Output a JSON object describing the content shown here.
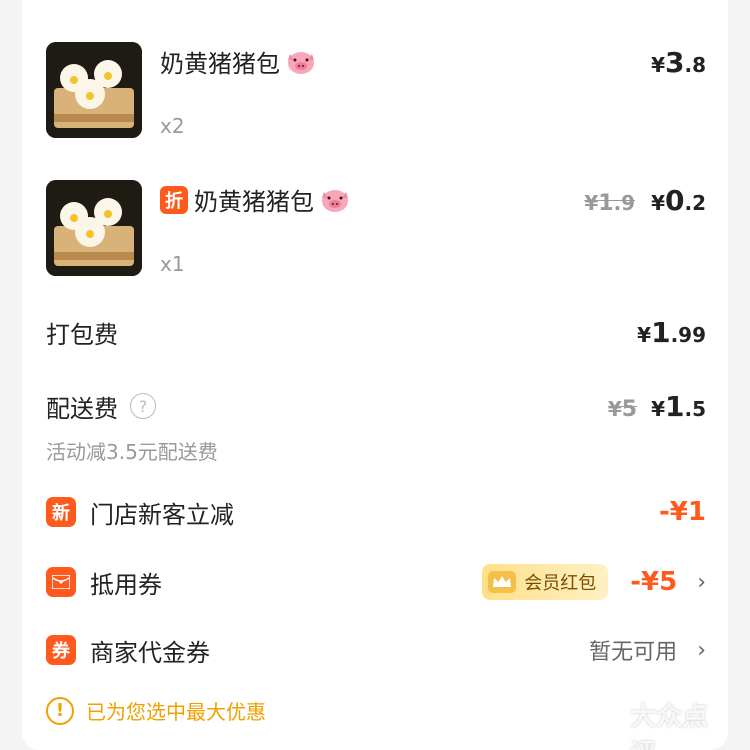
{
  "items": [
    {
      "name": "奶黄猪猪包",
      "name_emoji": "pig-face-emoji",
      "quantity": "x2",
      "price_symbol": "¥",
      "price_int": "3",
      "price_dec": ".8"
    },
    {
      "tag": "折",
      "name": "奶黄猪猪包",
      "name_emoji": "pig-face-emoji",
      "quantity": "x1",
      "original_symbol": "¥",
      "original_int": "1",
      "original_dec": ".9",
      "price_symbol": "¥",
      "price_int": "0",
      "price_dec": ".2"
    }
  ],
  "packaging": {
    "label": "打包费",
    "symbol": "¥",
    "int": "1",
    "dec": ".99"
  },
  "delivery": {
    "label": "配送费",
    "help_icon": "?",
    "original_symbol": "¥",
    "original": "5",
    "symbol": "¥",
    "int": "1",
    "dec": ".5",
    "note": "活动减3.5元配送费"
  },
  "discounts": [
    {
      "icon_text": "新",
      "label": "门店新客立减",
      "value": "-¥1"
    },
    {
      "icon": "red-envelope-icon",
      "label": "抵用券",
      "vip_label": "会员红包",
      "value": "-¥5"
    },
    {
      "icon_text": "券",
      "label": "商家代金券",
      "value": "暂无可用"
    }
  ],
  "notice": {
    "icon": "!",
    "text": "已为您选中最大优惠"
  },
  "watermark": "大众点评",
  "colors": {
    "accent": "#ff5a1e",
    "notice": "#f0a000"
  }
}
